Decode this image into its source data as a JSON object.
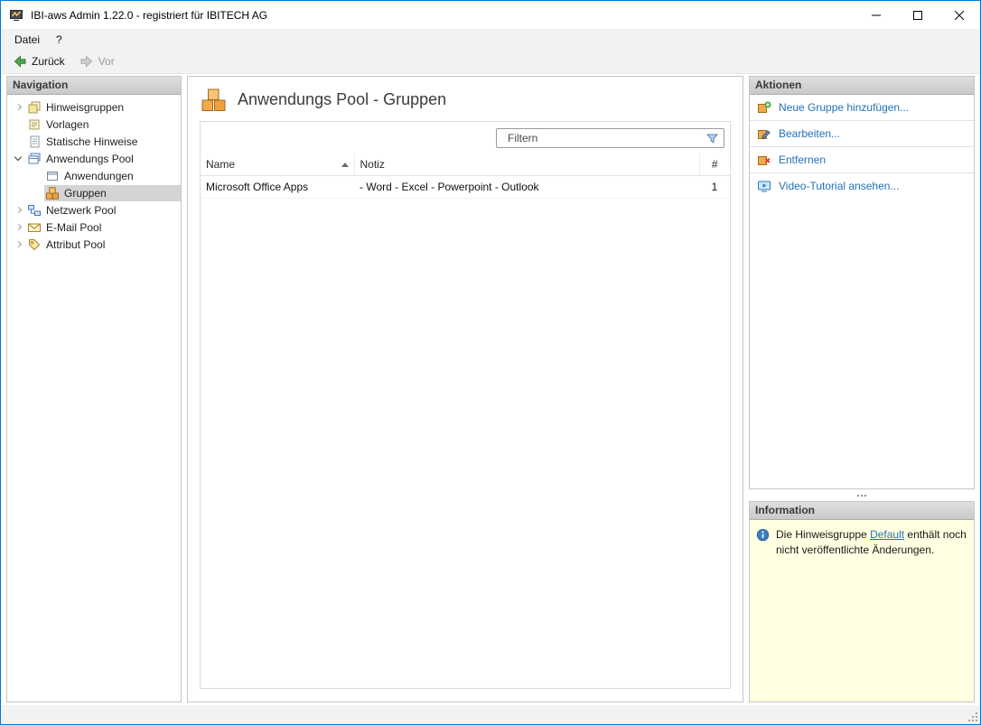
{
  "window": {
    "title": "IBI-aws Admin 1.22.0 - registriert für IBITECH AG"
  },
  "menubar": {
    "items": [
      {
        "label": "Datei"
      },
      {
        "label": "?"
      }
    ]
  },
  "toolbar": {
    "back": "Zurück",
    "forward": "Vor"
  },
  "navigation": {
    "header": "Navigation",
    "items": [
      {
        "label": "Hinweisgruppen",
        "expander": "collapsed",
        "level": 0,
        "selected": false
      },
      {
        "label": "Vorlagen",
        "expander": "none",
        "level": 0,
        "selected": false
      },
      {
        "label": "Statische Hinweise",
        "expander": "none",
        "level": 0,
        "selected": false
      },
      {
        "label": "Anwendungs Pool",
        "expander": "expanded",
        "level": 0,
        "selected": false
      },
      {
        "label": "Anwendungen",
        "expander": "none",
        "level": 1,
        "selected": false
      },
      {
        "label": "Gruppen",
        "expander": "none",
        "level": 1,
        "selected": true
      },
      {
        "label": "Netzwerk Pool",
        "expander": "collapsed",
        "level": 0,
        "selected": false
      },
      {
        "label": "E-Mail Pool",
        "expander": "collapsed",
        "level": 0,
        "selected": false
      },
      {
        "label": "Attribut Pool",
        "expander": "collapsed",
        "level": 0,
        "selected": false
      }
    ]
  },
  "main": {
    "title": "Anwendungs Pool - Gruppen",
    "filter_placeholder": "Filtern",
    "table": {
      "columns": [
        {
          "label": "Name",
          "sort": "asc"
        },
        {
          "label": "Notiz",
          "sort": "none"
        },
        {
          "label": "#",
          "sort": "none"
        }
      ],
      "rows": [
        {
          "name": "Microsoft Office Apps",
          "notiz": "- Word - Excel - Powerpoint - Outlook",
          "count": "1"
        }
      ]
    }
  },
  "aktionen": {
    "header": "Aktionen",
    "items": [
      {
        "label": "Neue Gruppe hinzufügen..."
      },
      {
        "label": "Bearbeiten..."
      },
      {
        "label": "Entfernen"
      },
      {
        "label": "Video-Tutorial ansehen..."
      }
    ]
  },
  "information": {
    "header": "Information",
    "text_before": "Die Hinweisgruppe ",
    "link_label": "Default",
    "text_after": " enthält noch nicht veröffentlichte Änderungen."
  },
  "colors": {
    "window_border": "#0079d8",
    "link_blue": "#2272b9",
    "info_background": "#ffffe1",
    "selection_background": "#d4d4d4"
  }
}
